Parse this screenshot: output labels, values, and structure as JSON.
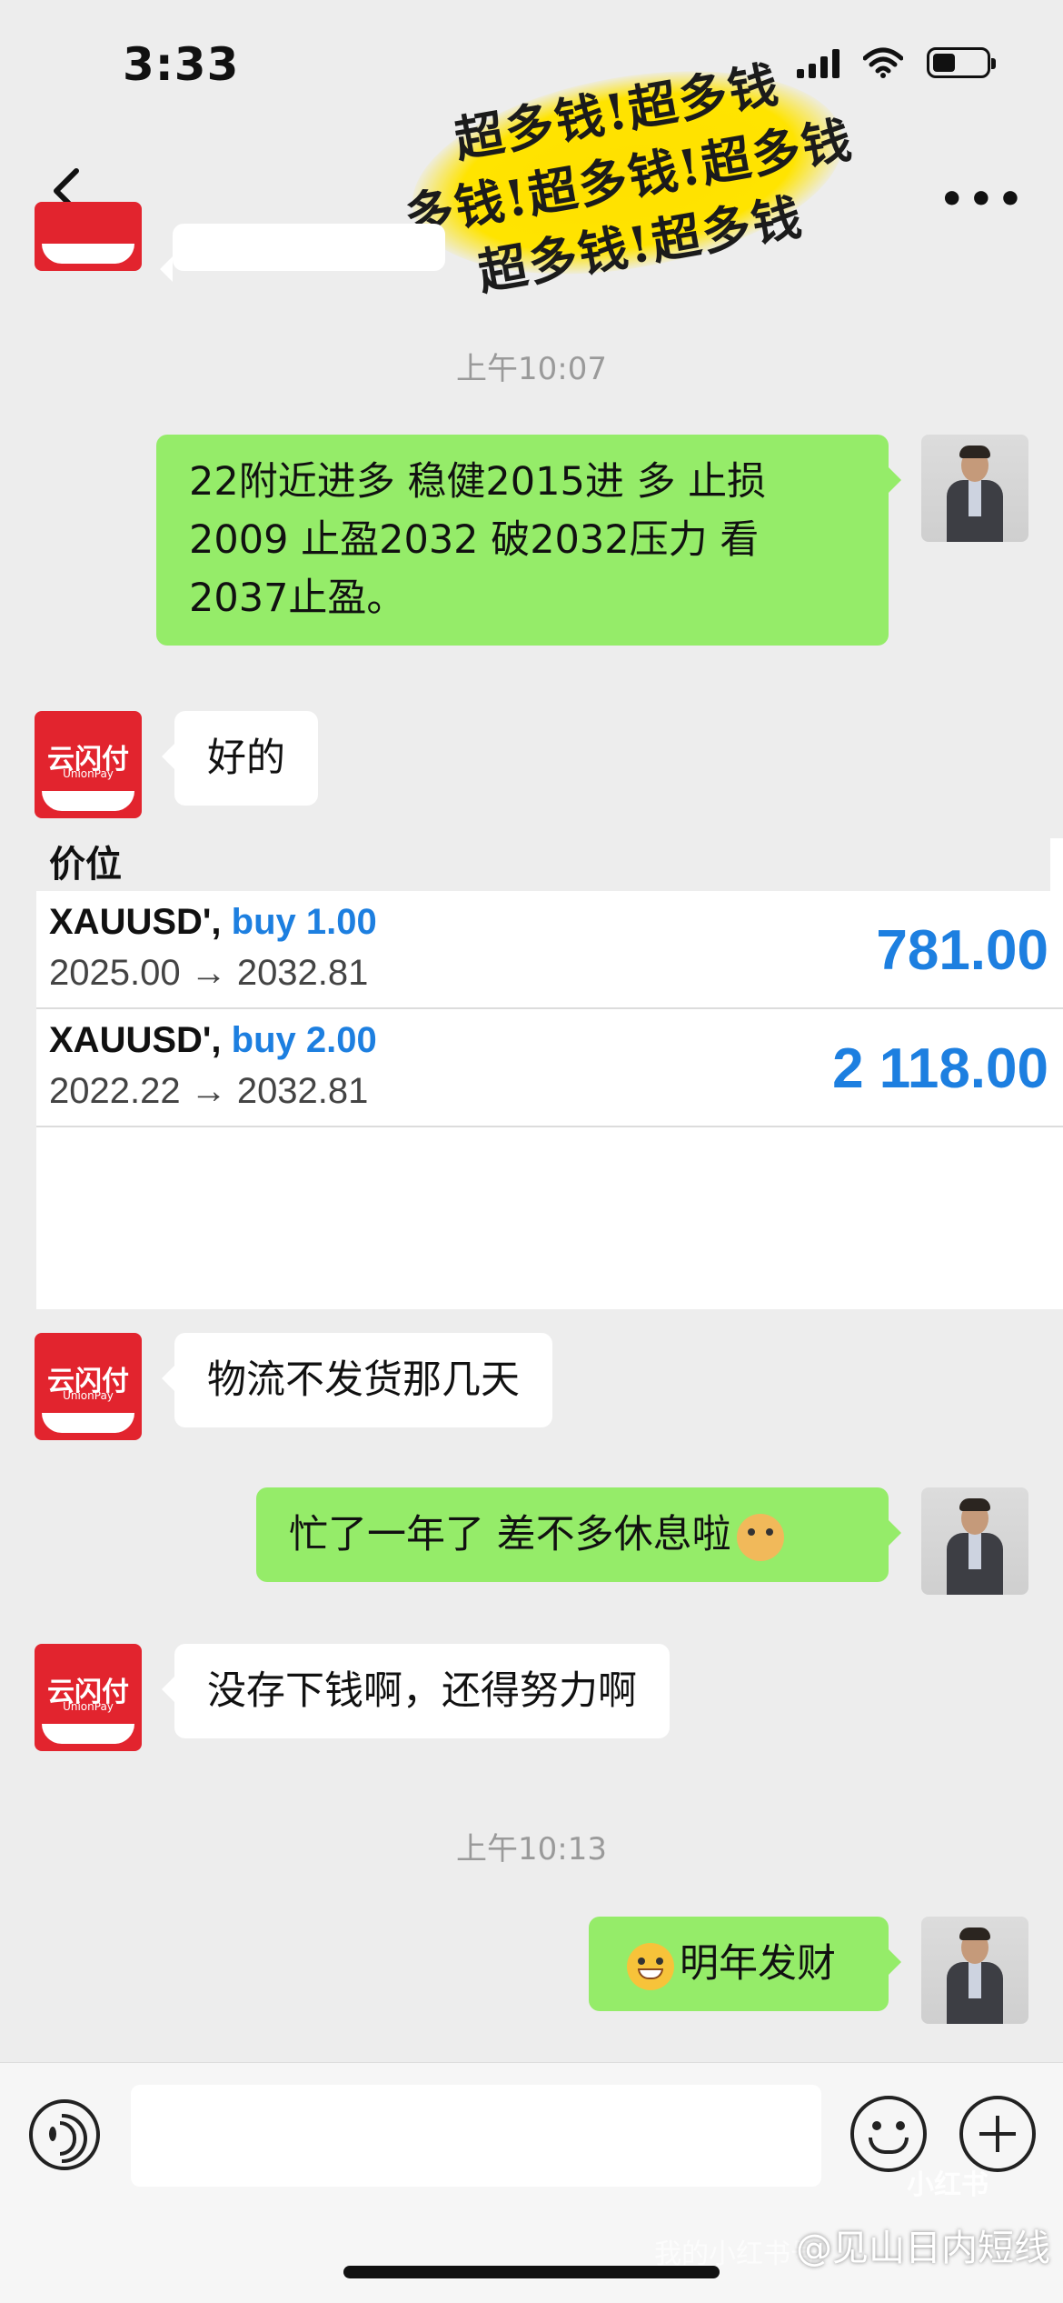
{
  "status_bar": {
    "time": "3:33"
  },
  "sticker": {
    "lines": [
      "超多钱!超多钱",
      "多钱!超多钱!超多钱",
      "超多钱!超多钱"
    ]
  },
  "messages": {
    "ts1": "上午10:07",
    "m1": "  22附近进多 稳健2015进 多 止损2009 止盈2032 破2032压力 看2037止盈。",
    "m2": "好的",
    "m3": "物流不发货那几天",
    "m4": "忙了一年了 差不多休息啦",
    "m5": "没存下钱啊，还得努力啊",
    "ts2": "上午10:13",
    "m6": "明年发财"
  },
  "avatar_brand": {
    "name": "云闪付",
    "sub": "UnionPay"
  },
  "trade": {
    "title": "价位",
    "rows": [
      {
        "symbol": "XAUUSD',",
        "side": "buy 1.00",
        "prices": "2025.00 → 2032.81",
        "profit": "781.00"
      },
      {
        "symbol": "XAUUSD',",
        "side": "buy 2.00",
        "prices": "2022.22 → 2032.81",
        "profit": "2 118.00"
      }
    ]
  },
  "watermark": {
    "handle": "@见山日内短线",
    "small": "小红书",
    "id_prefix": "我的小红书号"
  },
  "colors": {
    "bubble_out": "#95ec69",
    "bubble_in": "#ffffff",
    "profit": "#1d7fe0",
    "brand_red": "#e2242e"
  }
}
